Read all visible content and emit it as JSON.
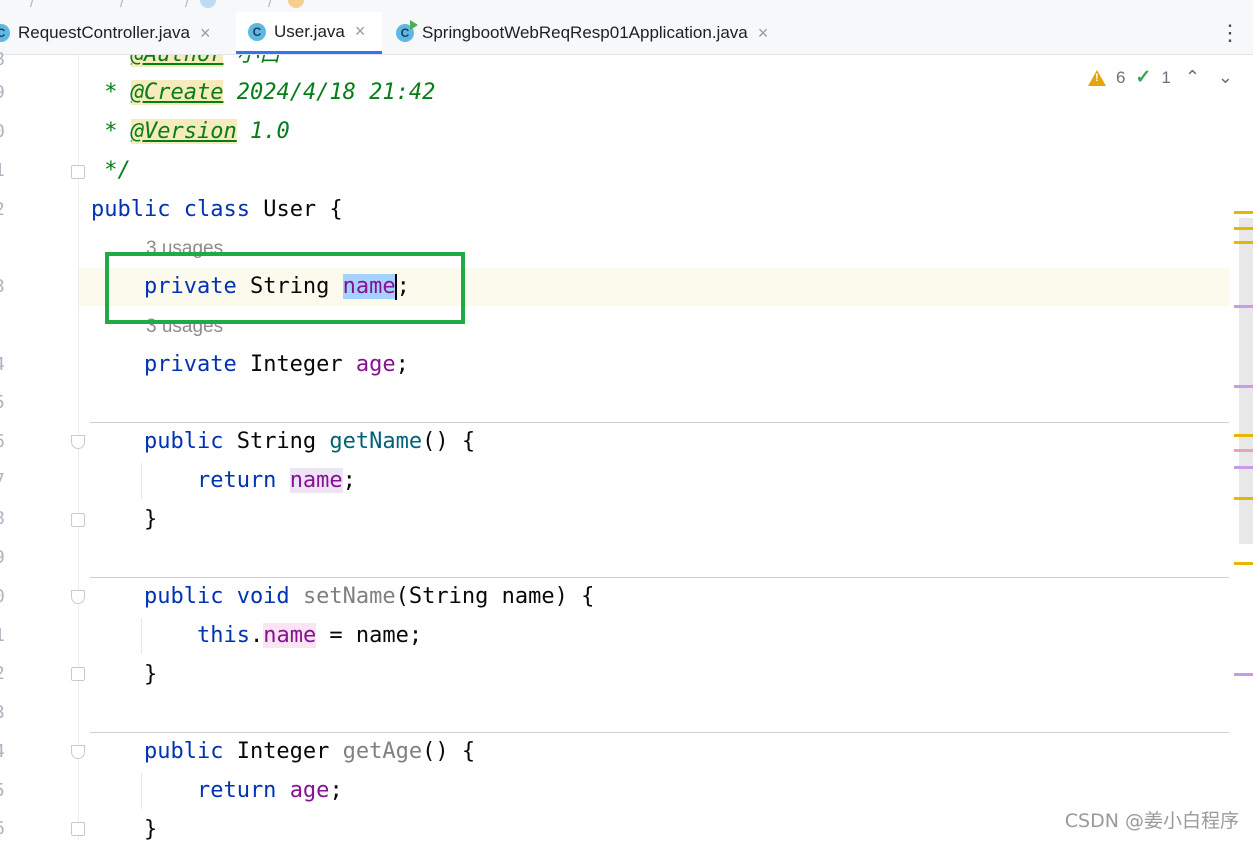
{
  "tabs": [
    {
      "label": "RequestController.java",
      "icon": "class-icon",
      "active": false
    },
    {
      "label": "User.java",
      "icon": "class-icon",
      "active": true
    },
    {
      "label": "SpringbootWebReqResp01Application.java",
      "icon": "spring-boot-app-icon",
      "active": false
    }
  ],
  "tab_icon_letter": "C",
  "tab_close_glyph": "×",
  "more_glyph": "⋮",
  "inspections": {
    "warnings": "6",
    "weak_warnings": "1",
    "up_glyph": "⌃",
    "down_glyph": "⌄"
  },
  "line_numbers": [
    "8",
    "9",
    "0",
    "1",
    "2",
    "3",
    "4",
    "5",
    "6",
    "7",
    "8",
    "9",
    "0",
    "1",
    "2",
    "3",
    "4",
    "5",
    "6"
  ],
  "code": {
    "l8_a": " * ",
    "l8_tag": "@Author",
    "l8_val": " 小白",
    "l9_a": " * ",
    "l9_tag": "@Create",
    "l9_val": " 2024/4/18 21:42",
    "l10_a": " * ",
    "l10_tag": "@Version",
    "l10_val": " 1.0",
    "l11": " */",
    "l12_kw": "public class",
    "l12_rest": " User {",
    "usages_1": "3 usages",
    "l13_kw": "    private",
    "l13_type": " String ",
    "l13_field": "name",
    "l13_end": ";",
    "usages_2": "3 usages",
    "l14_kw": "    private",
    "l14_type": " Integer ",
    "l14_field": "age",
    "l14_end": ";",
    "l16_kw": "    public",
    "l16_type": " String ",
    "l16_method": "getName",
    "l16_end": "() {",
    "l17_kw": "        return",
    "l17_sp": " ",
    "l17_field": "name",
    "l17_end": ";",
    "l18": "    }",
    "l20_kw": "    public void",
    "l20_sp": " ",
    "l20_method": "setName",
    "l20_end": "(String name) {",
    "l21_kw": "        this",
    "l21_dot": ".",
    "l21_field": "name",
    "l21_end": " = name;",
    "l22": "    }",
    "l24_kw": "    public",
    "l24_type": " Integer ",
    "l24_method": "getAge",
    "l24_end": "() {",
    "l25_kw": "        return",
    "l25_sp": " ",
    "l25_field": "age",
    "l25_end": ";",
    "l26": "    }"
  },
  "watermark": "CSDN @姜小白程序",
  "colors": {
    "keyword": "#0033b3",
    "field": "#871094",
    "method": "#00627a",
    "doc": "#067d17",
    "highlight_box": "#1faa45",
    "selection": "#a6d2ff"
  }
}
